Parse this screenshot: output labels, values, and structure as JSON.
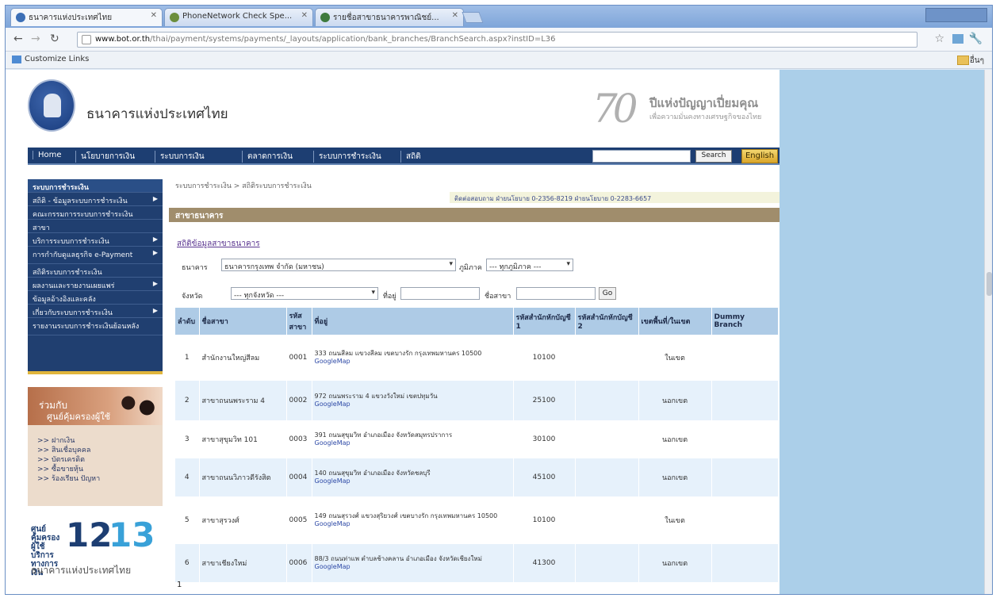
{
  "browser": {
    "tabs": [
      {
        "label": "ธนาคารแห่งประเทศไทย"
      },
      {
        "label": "PhoneNetwork Check Spe..."
      },
      {
        "label": "รายชื่อสาขาธนาคารพาณิชย์..."
      }
    ],
    "url_domain": "www.bot.or.th",
    "url_path": "/thai/payment/systems/payments/_layouts/application/bank_branches/BranchSearch.aspx?instID=L36",
    "bookmarks_left": "Customize Links",
    "bookmarks_right": "อื่นๆ"
  },
  "site": {
    "bank_name": "ธนาคารแห่งประเทศไทย",
    "anniv_number": "70",
    "anniv_title": "ปีแห่งปัญญาเปี่ยมคุณ",
    "anniv_sub": "เพื่อความมั่นคงทางเศรษฐกิจของไทย",
    "nav": [
      "Home",
      "นโยบายการเงิน",
      "ระบบการเงิน",
      "ตลาดการเงิน",
      "ระบบการชำระเงิน",
      "สถิติ"
    ],
    "search_button": "Search",
    "english_button": "English"
  },
  "sidebar": {
    "items": [
      {
        "label": "ระบบการชำระเงิน",
        "arrow": false,
        "head": true
      },
      {
        "label": "สถิติ - ข้อมูลระบบการชำระเงิน",
        "arrow": true
      },
      {
        "label": "คณะกรรมการระบบการชำระเงิน",
        "arrow": false
      },
      {
        "label": "สาขา",
        "arrow": false
      },
      {
        "label": "บริการระบบการชำระเงิน",
        "arrow": true
      },
      {
        "label": "การกำกับดูแลธุรกิจ e-Payment",
        "arrow": true
      },
      {
        "label": "สถิติระบบการชำระเงิน",
        "arrow": false
      },
      {
        "label": "ผลงานและรายงานเผยแพร่",
        "arrow": true
      },
      {
        "label": "ข้อมูลอ้างอิงและคลัง",
        "arrow": false
      },
      {
        "label": "เกี่ยวกับระบบการชำระเงิน",
        "arrow": true
      },
      {
        "label": "รายงานระบบการชำระเงินย้อนหลัง",
        "arrow": false
      }
    ]
  },
  "promo": {
    "line1": "ร่วมกับ",
    "line2": "ศูนย์คุ้มครองผู้ใช้",
    "links": [
      ">> ฝากเงิน",
      ">> สินเชื่อบุคคล",
      ">> บัตรเครดิต",
      ">> ซื้อขายหุ้น",
      ">> ร้องเรียน ปัญหา"
    ]
  },
  "callcenter": {
    "label": "ศูนย์คุ้มครองผู้ใช้บริการทางการเงิน",
    "num1": "12",
    "num2": "13",
    "bank": "ธนาคารแห่งประเทศไทย"
  },
  "content": {
    "breadcrumb": "ระบบการชำระเงิน > สถิติระบบการชำระเงิน",
    "contact": "ติดต่อสอบถาม ฝ่ายนโยบาย 0-2356-8219 ฝ่ายนโยบาย 0-2283-6657",
    "section_title": "สาขาธนาคาร",
    "sub_link": "สถิติข้อมูลสาขาธนาคาร",
    "filter_bank_label": "ธนาคาร",
    "filter_bank_value": "ธนาคารกรุงเทพ จำกัด (มหาชน)",
    "filter_region_label": "ภูมิภาค",
    "filter_region_value": "--- ทุกภูมิภาค ---",
    "filter_province_label": "จังหวัด",
    "filter_province_value": "--- ทุกจังหวัด ---",
    "filter_addr_label": "ที่อยู่",
    "filter_name_label": "ชื่อสาขา",
    "go_button": "Go",
    "columns": [
      "ลำดับ",
      "ชื่อสาขา",
      "รหัสสาขา",
      "ที่อยู่",
      "รหัสสำนักหักบัญชี 1",
      "รหัสสำนักหักบัญชี 2",
      "เขตพื้นที่/ในเขต",
      "Dummy Branch"
    ],
    "rows": [
      {
        "no": "1",
        "name": "สำนักงานใหญ่สีลม",
        "code": "0001",
        "address": "333 ถนนสีลม แขวงสีลม เขตบางรัก กรุงเทพมหานคร 10500",
        "map": "GoogleMap",
        "clear1": "10100",
        "clear2": "",
        "area": "ในเขต",
        "dummy": ""
      },
      {
        "no": "2",
        "name": "สาขาถนนพระราม 4",
        "code": "0002",
        "address": "972 ถนนพระราม 4 แขวงวังใหม่ เขตปทุมวัน",
        "map": "GoogleMap",
        "clear1": "25100",
        "clear2": "",
        "area": "นอกเขต",
        "dummy": ""
      },
      {
        "no": "3",
        "name": "สาขาสุขุมวิท 101",
        "code": "0003",
        "address": "391 ถนนสุขุมวิท อำเภอเมือง จังหวัดสมุทรปราการ",
        "map": "GoogleMap",
        "clear1": "30100",
        "clear2": "",
        "area": "นอกเขต",
        "dummy": ""
      },
      {
        "no": "4",
        "name": "สาขาถนนวิภาวดีรังสิต",
        "code": "0004",
        "address": "140 ถนนสุขุมวิท อำเภอเมือง จังหวัดชลบุรี",
        "map": "GoogleMap",
        "clear1": "45100",
        "clear2": "",
        "area": "นอกเขต",
        "dummy": ""
      },
      {
        "no": "5",
        "name": "สาขาสุรวงศ์",
        "code": "0005",
        "address": "149 ถนนสุรวงศ์ แขวงสุริยวงศ์ เขตบางรัก กรุงเทพมหานคร 10500",
        "map": "GoogleMap",
        "clear1": "10100",
        "clear2": "",
        "area": "ในเขต",
        "dummy": ""
      },
      {
        "no": "6",
        "name": "สาขาเชียงใหม่",
        "code": "0006",
        "address": "88/3 ถนนท่าแพ ตำบลช้างคลาน อำเภอเมือง จังหวัดเชียงใหม่",
        "map": "GoogleMap",
        "clear1": "41300",
        "clear2": "",
        "area": "นอกเขต",
        "dummy": ""
      }
    ],
    "page": "1"
  }
}
